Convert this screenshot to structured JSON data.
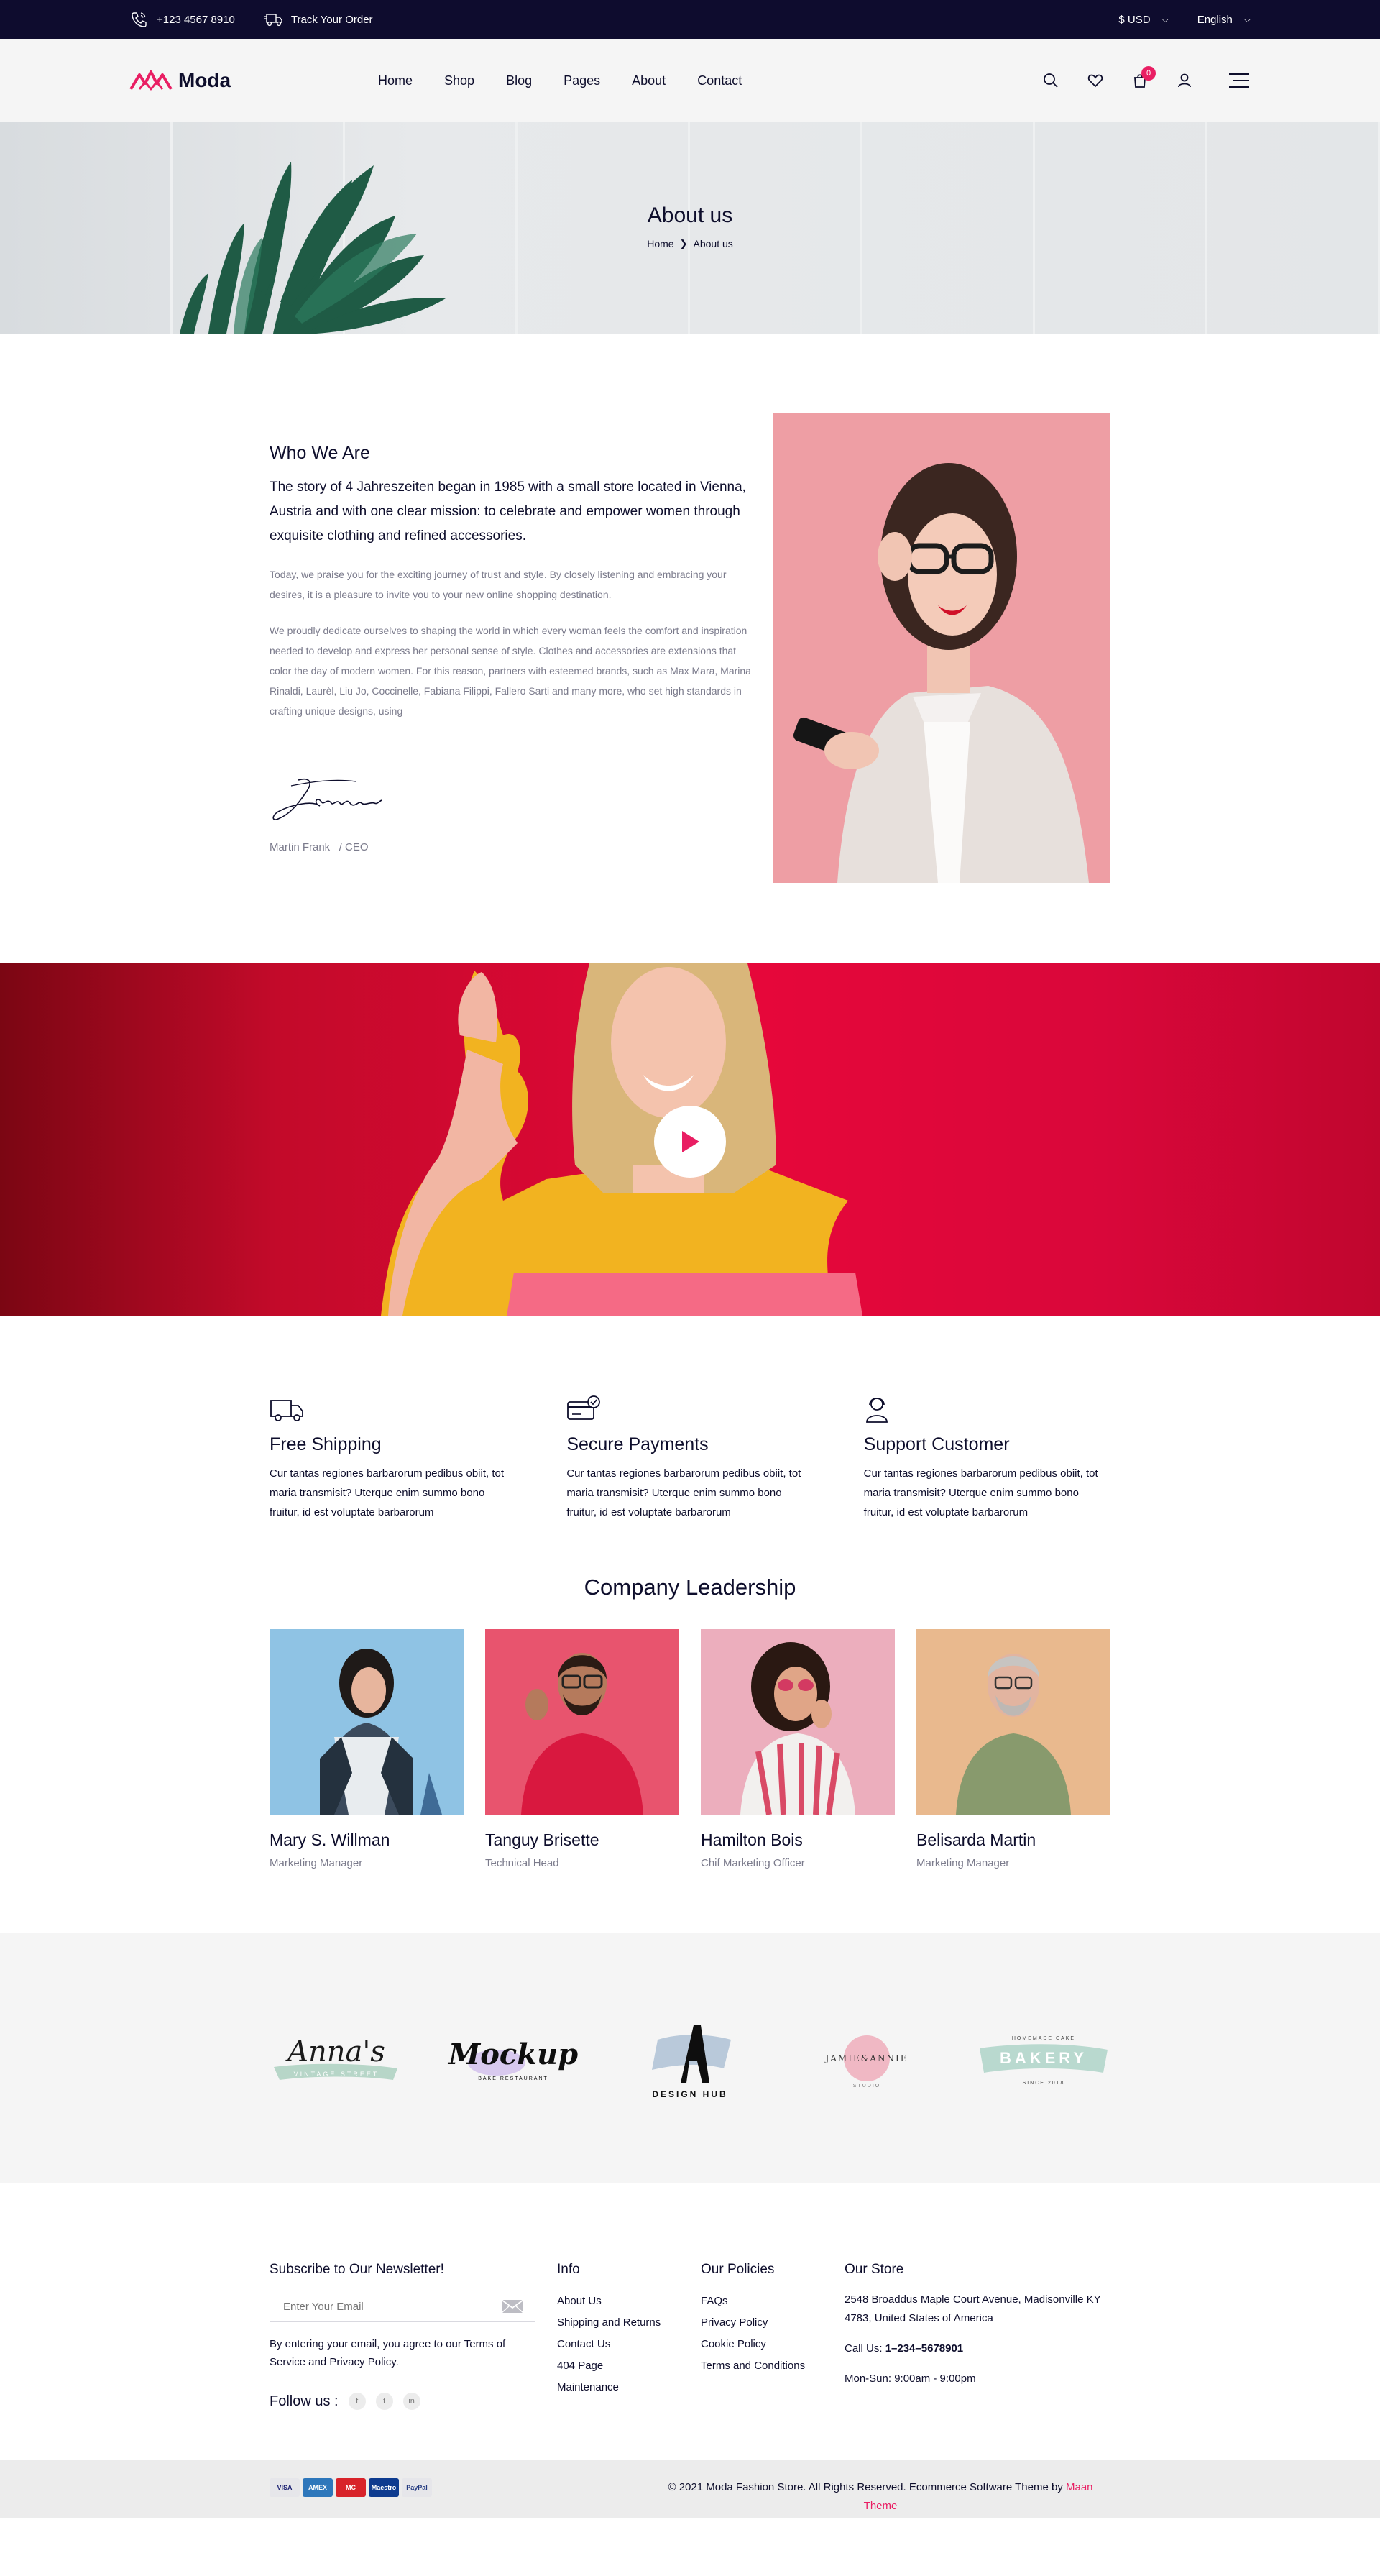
{
  "topbar": {
    "phone": "+123 4567 8910",
    "track_order": "Track Your Order",
    "currency": "$ USD",
    "language": "English"
  },
  "header": {
    "logo_text": "Moda",
    "nav": [
      "Home",
      "Shop",
      "Blog",
      "Pages",
      "About",
      "Contact"
    ],
    "cart_count": "0",
    "icons": [
      "search-icon",
      "heart-icon",
      "cart-icon",
      "user-icon",
      "menu-icon"
    ]
  },
  "hero": {
    "title": "About us",
    "breadcrumb": [
      "Home",
      "About us"
    ]
  },
  "about": {
    "heading": "Who We Are",
    "lead": "The story of 4 Jahreszeiten began in 1985 with a small store located in Vienna, Austria and with one clear mission: to celebrate and empower women through exquisite clothing and refined accessories.",
    "para1": "Today, we praise you for the exciting journey of trust and style. By closely listening and embracing your desires, it is a pleasure to invite you to your new online shopping destination.",
    "para2": "We proudly dedicate ourselves to shaping the world in which every woman feels the comfort and inspiration needed to develop and express her personal sense of style. Clothes and accessories are extensions that color the day of modern women. For this reason, partners with esteemed brands, such as Max Mara, Marina Rinaldi, Laurèl, Liu Jo, Coccinelle, Fabiana Filippi, Fallero Sarti and many more, who set high standards in crafting unique designs, using",
    "signature_name": "Martin Frank",
    "signature_role": "/ CEO"
  },
  "features": [
    {
      "icon": "truck-icon",
      "title": "Free Shipping",
      "text": "Cur tantas regiones barbarorum pedibus obiit, tot maria transmisit? Uterque enim summo bono fruitur, id est voluptate barbarorum"
    },
    {
      "icon": "credit-card-icon",
      "title": "Secure Payments",
      "text": "Cur tantas regiones barbarorum pedibus obiit, tot maria transmisit? Uterque enim summo bono fruitur, id est voluptate barbarorum"
    },
    {
      "icon": "support-agent-icon",
      "title": "Support Customer",
      "text": "Cur tantas regiones barbarorum pedibus obiit, tot maria transmisit? Uterque enim summo bono fruitur, id est voluptate barbarorum"
    }
  ],
  "leadership": {
    "heading": "Company Leadership",
    "members": [
      {
        "name": "Mary S. Willman",
        "role": "Marketing Manager"
      },
      {
        "name": "Tanguy Brisette",
        "role": "Technical Head"
      },
      {
        "name": "Hamilton Bois",
        "role": "Chif Marketing Officer"
      },
      {
        "name": "Belisarda Martin",
        "role": "Marketing Manager"
      }
    ]
  },
  "brands": {
    "annas": "Anna's",
    "annas_sub": "VINTAGE STREET",
    "mockup": "Mockup",
    "mockup_sub": "BAKE RESTAURANT",
    "design_hub": "DESIGN HUB",
    "jamie": "JAMIE&ANNIE",
    "jamie_sub": "STUDIO",
    "bakery_top": "HOMEMADE CAKE",
    "bakery": "BAKERY",
    "bakery_sub": "SINCE 2018"
  },
  "footer": {
    "newsletter_title": "Subscribe to Our Newsletter!",
    "email_placeholder": "Enter Your Email",
    "newsletter_note": "By entering your email, you agree to our Terms of Service and Privacy Policy.",
    "follow_label": "Follow us :",
    "socials": [
      "f",
      "t",
      "in"
    ],
    "info_title": "Info",
    "info_links": [
      "About Us",
      "Shipping and Returns",
      "Contact Us",
      "404 Page",
      "Maintenance"
    ],
    "policies_title": "Our Policies",
    "policies_links": [
      "FAQs",
      "Privacy Policy",
      "Cookie Policy",
      "Terms and Conditions"
    ],
    "store_title": "Our Store",
    "store_address": "2548 Broaddus Maple Court Avenue, Madisonville KY 4783, United States of America",
    "call_label": "Call Us: ",
    "call_number": "1–234–5678901",
    "hours": "Mon-Sun: 9:00am - 9:00pm"
  },
  "bottom": {
    "cards": [
      "VISA",
      "AMEX",
      "MC",
      "Maestro",
      "PayPal"
    ],
    "copyright": "© 2021 Moda Fashion Store. All Rights Reserved. Ecommerce Software Theme by ",
    "theme_link": "Maan Theme"
  },
  "colors": {
    "accent": "#e91e63",
    "dark": "#0e0c2e",
    "muted": "#7b7b8c",
    "light_bg": "#f5f5f5"
  }
}
